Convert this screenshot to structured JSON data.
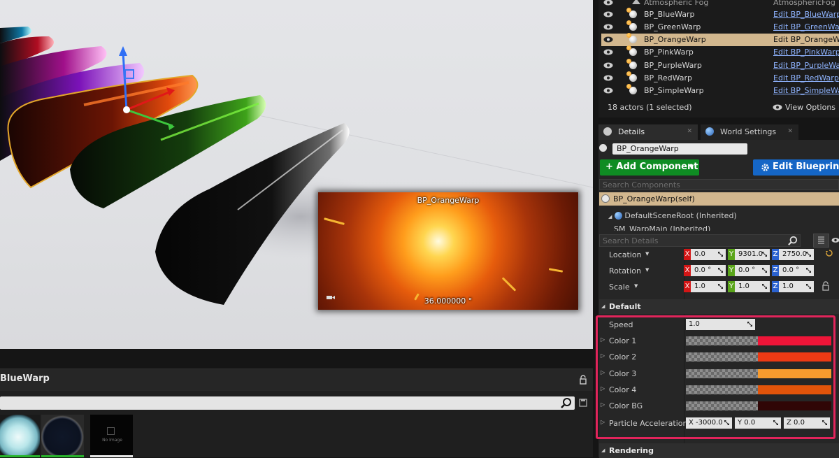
{
  "outliner": {
    "rows": [
      {
        "name": "Atmospheric Fog",
        "link": "AtmosphericFog",
        "state": "fog"
      },
      {
        "name": "BP_BlueWarp",
        "link": "Edit BP_BlueWarp",
        "state": "normal"
      },
      {
        "name": "BP_GreenWarp",
        "link": "Edit BP_GreenWarp",
        "state": "normal"
      },
      {
        "name": "BP_OrangeWarp",
        "link": "Edit BP_OrangeWarp",
        "state": "selected"
      },
      {
        "name": "BP_PinkWarp",
        "link": "Edit BP_PinkWarp",
        "state": "normal"
      },
      {
        "name": "BP_PurpleWarp",
        "link": "Edit BP_PurpleWarp",
        "state": "normal"
      },
      {
        "name": "BP_RedWarp",
        "link": "Edit BP_RedWarp",
        "state": "normal"
      },
      {
        "name": "BP_SimpleWarp",
        "link": "Edit BP_SimpleWarp",
        "state": "normal"
      }
    ],
    "actor_count": "18 actors (1 selected)",
    "view_options": "View Options"
  },
  "tabs": {
    "details": "Details",
    "world_settings": "World Settings"
  },
  "details": {
    "object_name": "BP_OrangeWarp",
    "add_component": "+ Add Component",
    "edit_blueprint": "Edit Blueprint",
    "search_components_placeholder": "Search Components",
    "self_component": "BP_OrangeWarp(self)",
    "tree_root": "DefaultSceneRoot (Inherited)",
    "tree_child": "SM_WarpMain (Inherited)",
    "search_details_placeholder": "Search Details",
    "transform": {
      "location": {
        "label": "Location",
        "x": "0.0",
        "y": "9301.0",
        "z": "2750.0"
      },
      "rotation": {
        "label": "Rotation",
        "x": "0.0 °",
        "y": "0.0 °",
        "z": "0.0 °"
      },
      "scale": {
        "label": "Scale",
        "x": "1.0",
        "y": "1.0",
        "z": "1.0"
      }
    },
    "default_section": "Default",
    "speed": {
      "label": "Speed",
      "value": "1.0"
    },
    "colors": [
      {
        "label": "Color 1",
        "color": "#ee1538"
      },
      {
        "label": "Color 2",
        "color": "#ed3a14"
      },
      {
        "label": "Color 3",
        "color": "#f79b2e"
      },
      {
        "label": "Color 4",
        "color": "#e2540a"
      },
      {
        "label": "Color BG",
        "color": "#300606"
      }
    ],
    "particle_acceleration": {
      "label": "Particle Acceleration",
      "x": "-3000.0",
      "y": "0.0",
      "z": "0.0"
    },
    "rendering_section": "Rendering"
  },
  "viewport": {
    "preview_title": "BP_OrangeWarp",
    "preview_value": "36.000000 °"
  },
  "content_browser": {
    "title": "BlueWarp",
    "thumb3_label": "No Image"
  }
}
